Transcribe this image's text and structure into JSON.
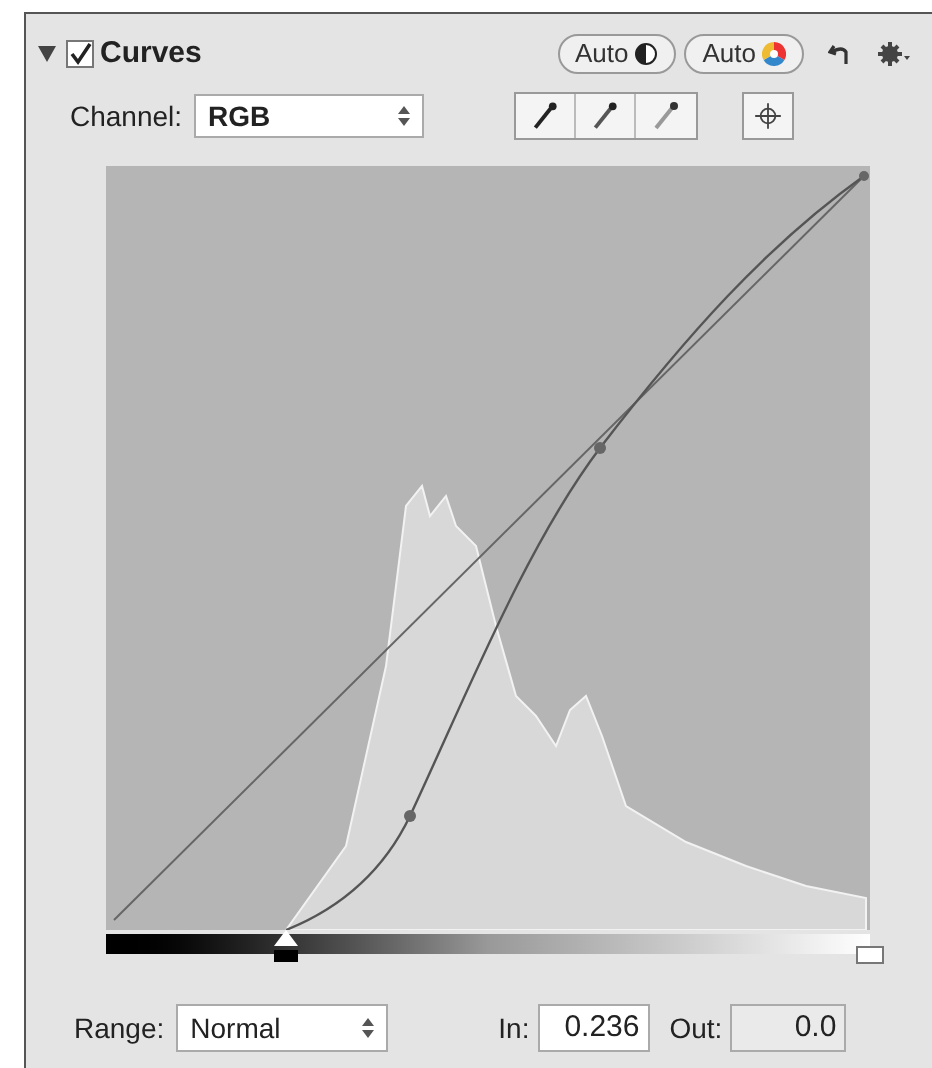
{
  "panel": {
    "title": "Curves",
    "expanded": true,
    "checked": true
  },
  "header_buttons": [
    {
      "label": "Auto",
      "kind": "contrast"
    },
    {
      "label": "Auto",
      "kind": "color"
    }
  ],
  "channel": {
    "label": "Channel:",
    "value": "RGB"
  },
  "black_point": {
    "level": 0.236
  },
  "white_point": {
    "level": 1
  },
  "range": {
    "label": "Range:",
    "value": "Normal"
  },
  "in_field": {
    "label": "In:",
    "value": "0.236"
  },
  "out_field": {
    "label": "Out:",
    "value": "0.0"
  }
}
